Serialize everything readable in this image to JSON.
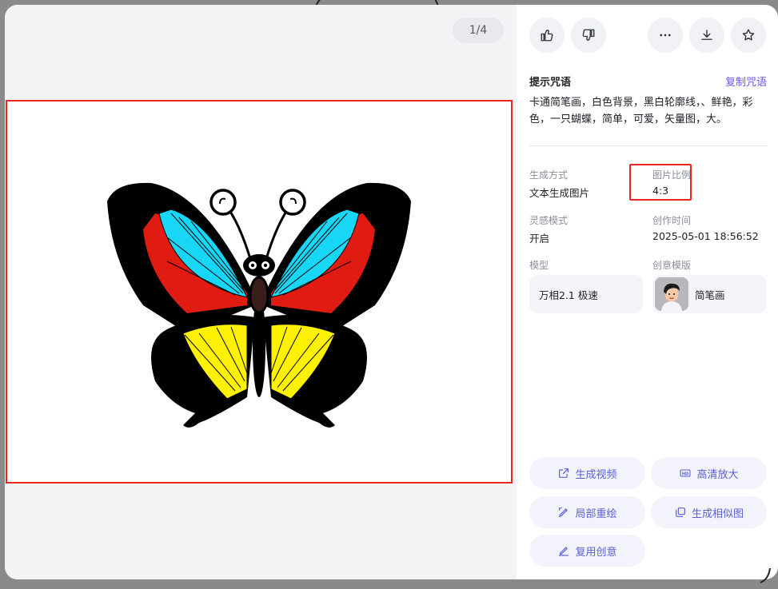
{
  "viewer": {
    "page_counter": "1/4"
  },
  "toolbar": {
    "like_label": "thumbs-up-icon",
    "dislike_label": "thumbs-down-icon",
    "more_label": "more-icon",
    "download_label": "download-icon",
    "favorite_label": "star-icon"
  },
  "prompt": {
    "title": "提示咒语",
    "copy_label": "复制咒语",
    "text": "卡通简笔画，白色背景，黑白轮廓线，、鲜艳，彩色，一只蝴蝶，简单，可爱，矢量图，大。"
  },
  "meta": {
    "gen_method_label": "生成方式",
    "gen_method_value": "文本生成图片",
    "ratio_label": "图片比例",
    "ratio_value": "4:3",
    "inspiration_label": "灵感模式",
    "inspiration_value": "开启",
    "created_label": "创作时间",
    "created_value": "2025-05-01 18:56:52",
    "model_label": "模型",
    "model_value": "万相2.1 极速",
    "template_label": "创意模版",
    "template_value": "简笔画"
  },
  "actions": {
    "gen_video": "生成视频",
    "hd_upscale": "高清放大",
    "partial_redraw": "局部重绘",
    "gen_similar": "生成相似图",
    "reuse_idea": "复用创意"
  },
  "colors": {
    "accent": "#6b55f2",
    "action_text": "#5a5fd6",
    "highlight": "#e8251e",
    "wing_blue": "#18d6f5",
    "wing_red": "#e01b12",
    "wing_yellow": "#fff200"
  }
}
